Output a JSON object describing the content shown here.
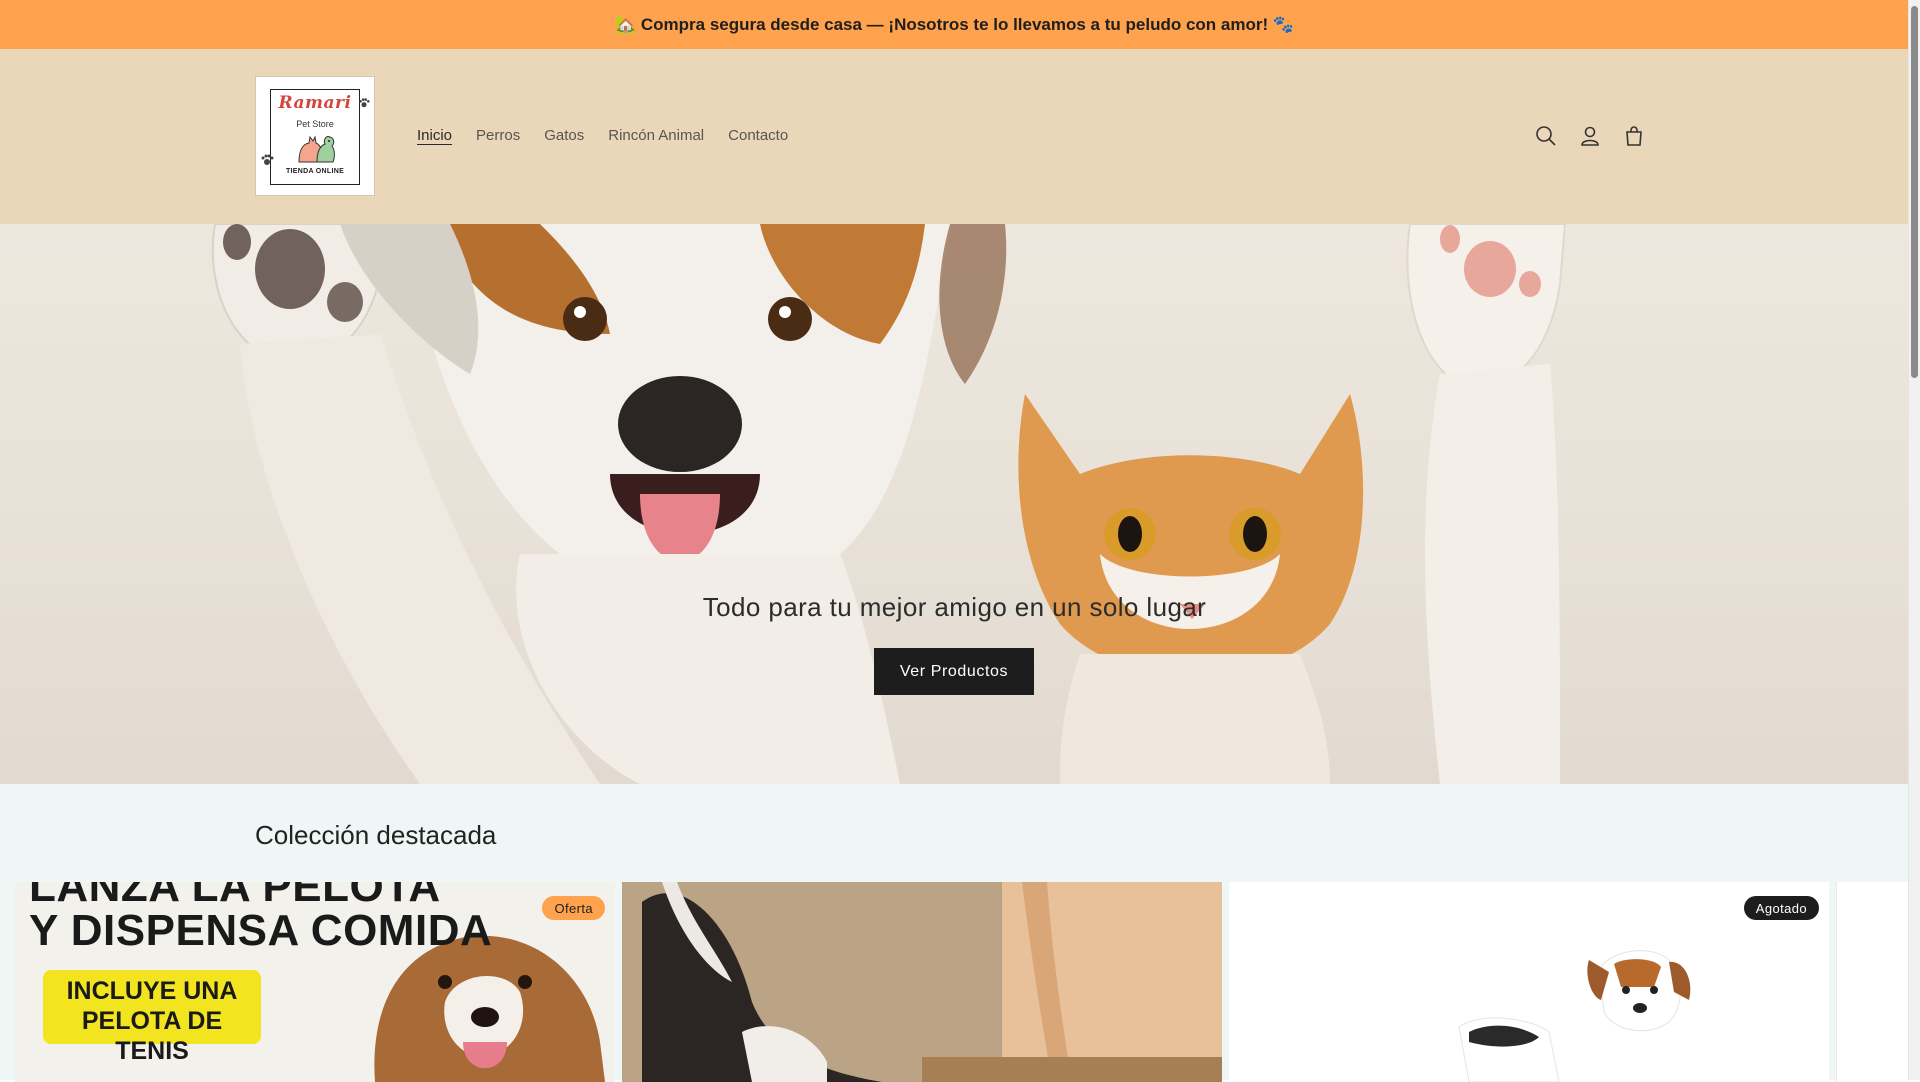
{
  "announcement": {
    "text": "🏡 Compra segura desde casa — ¡Nosotros te lo llevamos a tu peludo con amor! 🐾"
  },
  "header": {
    "logo": {
      "script": "Ramari",
      "sub": "Pet Store",
      "bottom": "TIENDA ONLINE"
    },
    "nav": [
      {
        "label": "Inicio",
        "active": true
      },
      {
        "label": "Perros"
      },
      {
        "label": "Gatos"
      },
      {
        "label": "Rincón Animal"
      },
      {
        "label": "Contacto"
      }
    ],
    "icons": [
      "search-icon",
      "account-icon",
      "cart-icon"
    ]
  },
  "hero": {
    "heading": "Todo para tu mejor amigo en un solo lugar",
    "button_label": "Ver Productos"
  },
  "collection": {
    "title": "Colección destacada",
    "cards": [
      {
        "badge": "Oferta",
        "promo_lines": [
          "LANZA LA PELOTA",
          "Y DISPENSA COMIDA"
        ],
        "promo_box": [
          "INCLUYE UNA",
          "PELOTA DE TENIS"
        ]
      },
      {
        "badge": ""
      },
      {
        "badge": "Agotado"
      }
    ]
  },
  "colors": {
    "announcement_bg": "#ffa24d",
    "header_bg": "#ead6b8",
    "collection_bg": "#eef7f5",
    "button_bg": "#1d1d1d"
  }
}
